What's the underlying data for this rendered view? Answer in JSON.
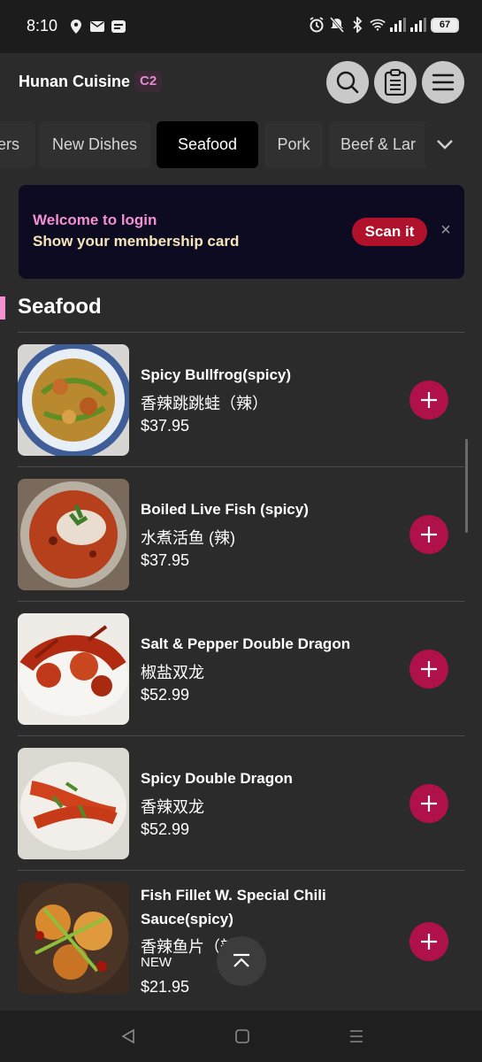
{
  "status_bar": {
    "time": "8:10",
    "battery": "67",
    "icons_left": [
      "location-icon",
      "mail-icon",
      "message-icon"
    ],
    "icons_right": [
      "alarm-icon",
      "mute-icon",
      "bluetooth-icon",
      "wifi-icon",
      "signal-icon",
      "signal-icon",
      "battery-icon"
    ]
  },
  "header": {
    "store_name": "Hunan Cuisine",
    "badge": "C2",
    "buttons": [
      "search-icon",
      "order-clipboard-icon",
      "menu-icon"
    ]
  },
  "tabs": {
    "items": [
      {
        "label": "ers"
      },
      {
        "label": "New Dishes"
      },
      {
        "label": "Seafood",
        "active": true
      },
      {
        "label": "Pork"
      },
      {
        "label": "Beef & Lar"
      }
    ],
    "more_icon": "chevron-down-icon"
  },
  "banner": {
    "line1": "Welcome to login",
    "line2": "Show your membership card",
    "button": "Scan it",
    "close": "×"
  },
  "section": {
    "title": "Seafood"
  },
  "dishes": [
    {
      "name": "Spicy Bullfrog(spicy)",
      "name_cn": "香辣跳跳蛙（辣）",
      "price": "$37.95",
      "tag": ""
    },
    {
      "name": "Boiled Live Fish (spicy)",
      "name_cn": "水煮活鱼 (辣)",
      "price": "$37.95",
      "tag": ""
    },
    {
      "name": "Salt & Pepper Double Dragon",
      "name_cn": "椒盐双龙",
      "price": "$52.99",
      "tag": ""
    },
    {
      "name": "Spicy Double Dragon",
      "name_cn": "香辣双龙",
      "price": "$52.99",
      "tag": ""
    },
    {
      "name": "Fish Fillet W. Special Chili Sauce(spicy)",
      "name_cn": "香辣鱼片（辣",
      "price": "$21.95",
      "tag": "NEW"
    }
  ],
  "colors": {
    "accent": "#b0114a",
    "banner_bg": "#0c0b22",
    "scan_button": "#b0112b",
    "section_marker": "#f48fd3"
  }
}
